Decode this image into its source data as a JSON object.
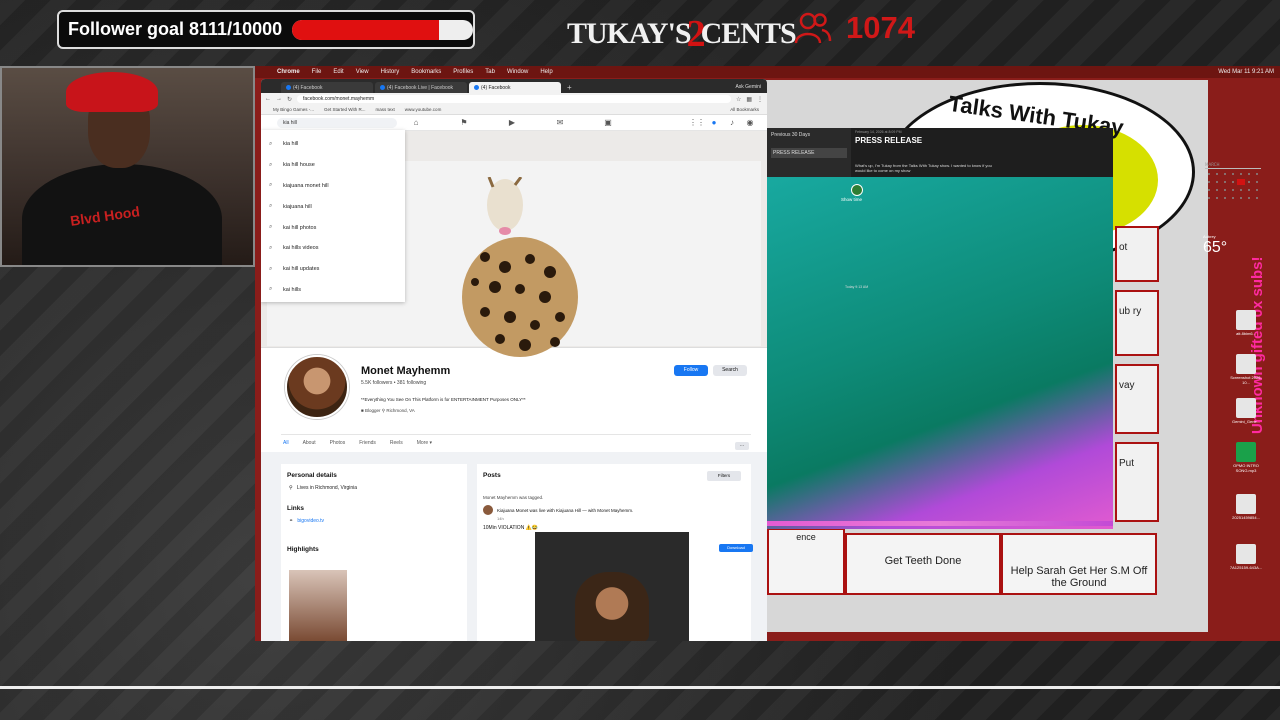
{
  "overlay": {
    "follower_goal_label": "Follower goal 8111/10000",
    "follower_goal_fraction": 0.811,
    "brand_left": "TUKAY'S",
    "brand_two": "2",
    "brand_right": "CENTS",
    "viewer_count": "1074",
    "colors": {
      "accent_red": "#e01010",
      "dark": "#0b0b0b"
    }
  },
  "webcam": {
    "shirt_text": "Blvd Hood"
  },
  "mac": {
    "menubar": [
      "Chrome",
      "File",
      "Edit",
      "View",
      "History",
      "Bookmarks",
      "Profiles",
      "Tab",
      "Window",
      "Help"
    ],
    "clock": "Wed Mar 11 9:21 AM"
  },
  "browser": {
    "tabs": [
      {
        "label": "(4) Facebook",
        "active": false
      },
      {
        "label": "(4) Facebook Live | Facebook",
        "active": false
      },
      {
        "label": "(4) Facebook",
        "active": true
      }
    ],
    "new_tab": "+",
    "ask_gemini": "Ask Gemini",
    "url": "facebook.com/monet.mayhemm",
    "bookmarks": [
      "My Bingo Games -...",
      "Get Started With R...",
      "mass text",
      "www.youtube.com"
    ],
    "all_bookmarks": "All Bookmarks"
  },
  "facebook": {
    "search_value": "kia hill",
    "suggestions": [
      "kia hill",
      "kia hill house",
      "kiajuana monet hill",
      "kiajuana hill",
      "kai hill photos",
      "kai hills videos",
      "kai hill updates",
      "kai hills"
    ],
    "profile": {
      "name": "Monet Mayhemm",
      "stats": "5.5K followers • 381 following",
      "bio": "**Everything You See On This Platform is for ENTERTAINMENT Purposes ONLY**",
      "category": "Blogger",
      "location": "Richmond, VA"
    },
    "follow_label": "Follow",
    "search_label": "Search",
    "tabs": [
      "All",
      "About",
      "Photos",
      "Friends",
      "Reels",
      "More ▾"
    ],
    "more_dots": "···",
    "details": {
      "title": "Personal details",
      "lives_in": "Lives in Richmond, Virginia",
      "links_title": "Links",
      "link": "bigovideo.tv",
      "highlights_title": "Highlights"
    },
    "posts": {
      "title": "Posts",
      "filters": "Filters",
      "tagged": "Monet Mayhemm was tagged.",
      "live_line": "Kiajuana Monet was live with Kiajuana Hill — with Monet Mayhemm.",
      "time": "14h",
      "caption": "10Min VIOLATION ⚠️😂",
      "download": "Download"
    }
  },
  "notes": {
    "sidebar_title": "Previous 30 Days",
    "sidebar_item": "PRESS RELEASE",
    "heading": "PRESS RELEASE",
    "date": "February 14, 2026 at 8:09 PM",
    "text": "What's up, I'm Tukay from the Talks With Tukay show. I wanted to know if you would like to come on my show",
    "show_time": "Show time",
    "today": "Today 9:13 AM"
  },
  "board": {
    "circle_text": "Talks With Tukay",
    "cell_teeth": "Get Teeth Done",
    "cell_sarah": "Help Sarah Get Her S.M Off the Ground",
    "side_cells": [
      "ot",
      "ub ry",
      "vay",
      "Put"
    ],
    "partial_cell": "ence"
  },
  "desktop": {
    "weather_temp": "65°",
    "weather_place": "Aubrey",
    "side_text": "Unknown gifted 0x subs!",
    "icons": [
      "att.8bim6...",
      "Screenshot 2026-10...",
      "Gemini_Gene...",
      "OPMO INTRO SONG.mp3",
      "20251459854...",
      "7A125159-643A..."
    ]
  }
}
